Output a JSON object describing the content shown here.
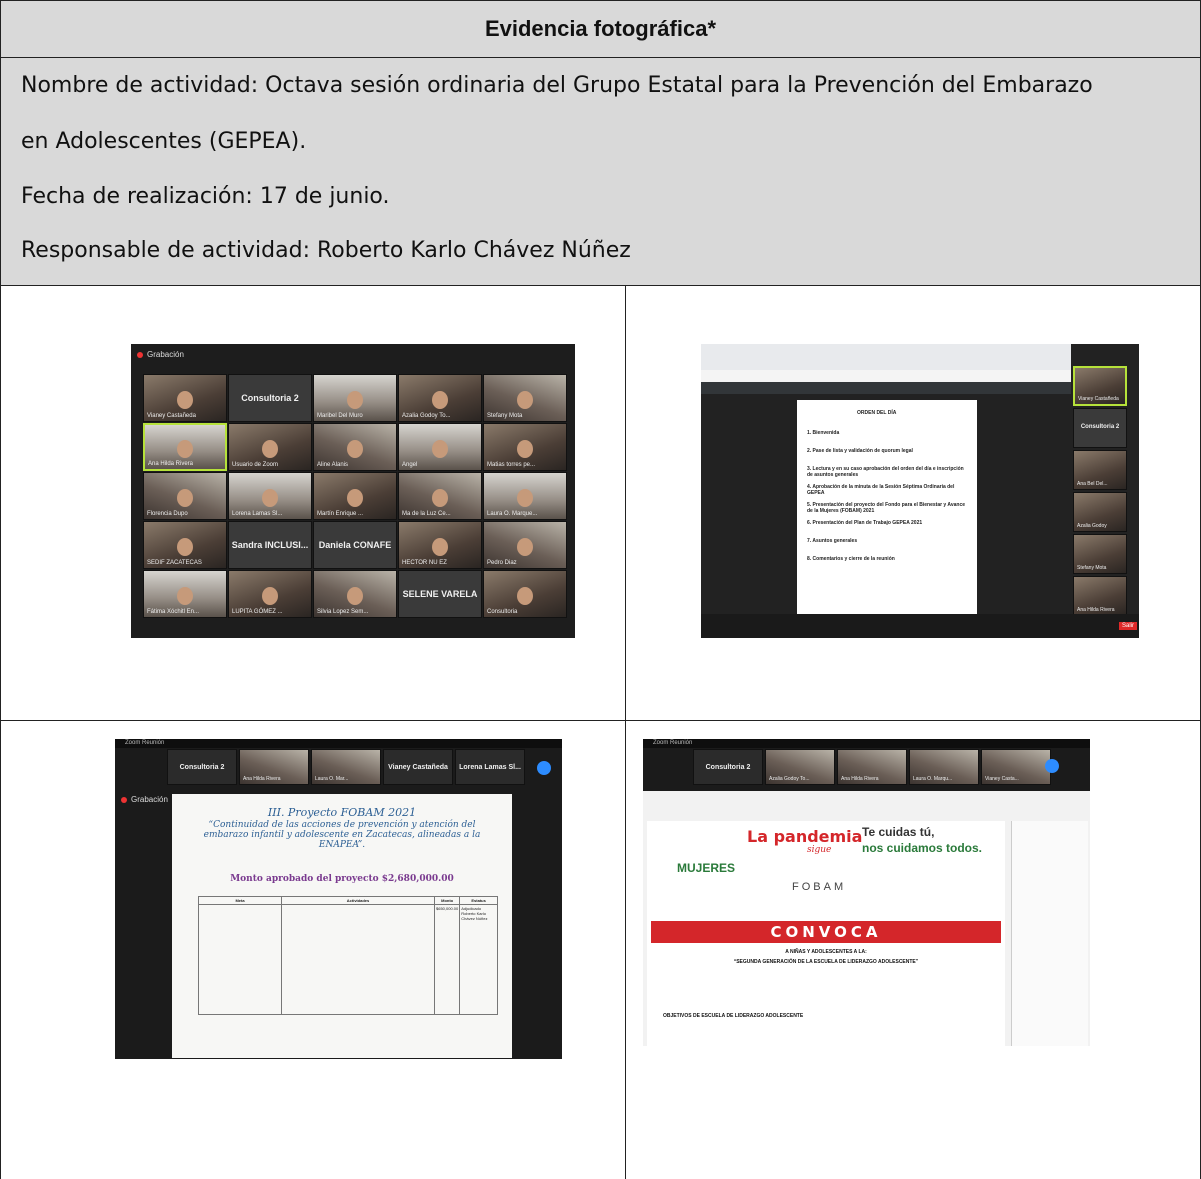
{
  "header": {
    "title": "Evidencia fotográfica*",
    "activity_line1": "Nombre de actividad: Octava sesión ordinaria  del Grupo Estatal para  la Prevención del Embarazo",
    "activity_line2": "en Adolescentes (GEPEA).",
    "date": "Fecha de realización: 17 de junio.",
    "responsible": "Responsable de actividad: Roberto Karlo Chávez Núñez"
  },
  "photo1": {
    "recording": "Grabación",
    "tiles": [
      "Vianey Castañeda",
      "Consultoria 2",
      "Maribel Del Muro",
      "Azalia Godoy To...",
      "Stefany Mota",
      "Ana Hilda Rivera",
      "Usuario de Zoom",
      "Aline Alanis",
      "Angel",
      "Matias torres pe...",
      "Florencia Dupo",
      "Lorena Lamas Sl...",
      "Martín Enrique ...",
      "Ma de la Luz Ce...",
      "Laura O. Marque...",
      "SEDIF ZACATECAS",
      "Sandra  INCLUSI...",
      "Daniela CONAFE",
      "HECTOR NU EZ",
      "Pedro Diaz",
      "Fátima Xóchitl En...",
      "LUPITA GÓMEZ ...",
      "Silvia Lopez Sem...",
      "SELENE VARELA",
      "Consultoria"
    ]
  },
  "photo2": {
    "doc_title": "ORDEN DEL DÍA",
    "items": [
      "1. Bienvenida",
      "2. Pase de lista y validación de quorum legal",
      "3. Lectura y en su caso aprobación del orden del día e inscripción de asuntos generales",
      "4. Aprobación de la minuta de la Sesión Séptima Ordinaria del GEPEA",
      "5. Presentación del proyecto del Fondo para el Bienestar y Avance de la Mujeres (FOBAM) 2021",
      "6. Presentación del Plan de Trabajo GEPEA 2021",
      "7. Asuntos generales",
      "8. Comentarios y cierre de la reunión"
    ],
    "side_tiles": [
      "Vianey Castañeda",
      "Consultoria 2",
      "Ana Bel Del...",
      "Azalia Godoy",
      "Stefany Mota",
      "Ana Hilda Rivera"
    ],
    "toolbar": [
      "Cancelar silenciar audio",
      "Iniciar video",
      "Participantes",
      "Chat",
      "Compartir pantalla",
      "Grabar",
      "Reacciones"
    ],
    "leave": "Salir"
  },
  "photo3": {
    "window": "Zoom Reunión",
    "top_tiles": [
      "Consultoria 2",
      "Ana Hilda Rivera",
      "Laura O. Mar...",
      "Vianey Castañeda",
      "Lorena Lamas Sl..."
    ],
    "recording": "Grabación",
    "heading1": "III. Proyecto FOBAM 2021",
    "heading2": "“Continuidad de las acciones de prevención y atención del embarazo infantil y adolescente en Zacatecas, alineadas a la ENAPEA”.",
    "amount": "Monto aprobado del proyecto $2,680,000.00",
    "table_headers": [
      "Meta",
      "Actividades",
      "Monto",
      "Estatus"
    ],
    "status": "Adjudicado",
    "monto": "$650,000.00",
    "responsible": "Roberto Karlo Chávez Núñez"
  },
  "photo4": {
    "window": "Zoom Reunión",
    "top_tiles": [
      "Consultoria 2",
      "Azalia Godoy To...",
      "Ana Hilda Rivera",
      "Laura O. Marqu...",
      "Vianey Casta..."
    ],
    "banner1": "La pandemia",
    "banner1b": "sigue",
    "banner2": "Te cuidas tú,",
    "banner3": "nos cuidamos todos.",
    "logo": "MUJERES",
    "fobam": "FOBAM",
    "convoca": "CONVOCA",
    "sub": "A NIÑAS Y ADOLESCENTES A LA:",
    "sub2": "“SEGUNDA GENERACIÓN DE LA ESCUELA DE LIDERAZGO ADOLESCENTE”",
    "objectives": "OBJETIVOS DE ESCUELA DE LIDERAZGO ADOLESCENTE"
  }
}
